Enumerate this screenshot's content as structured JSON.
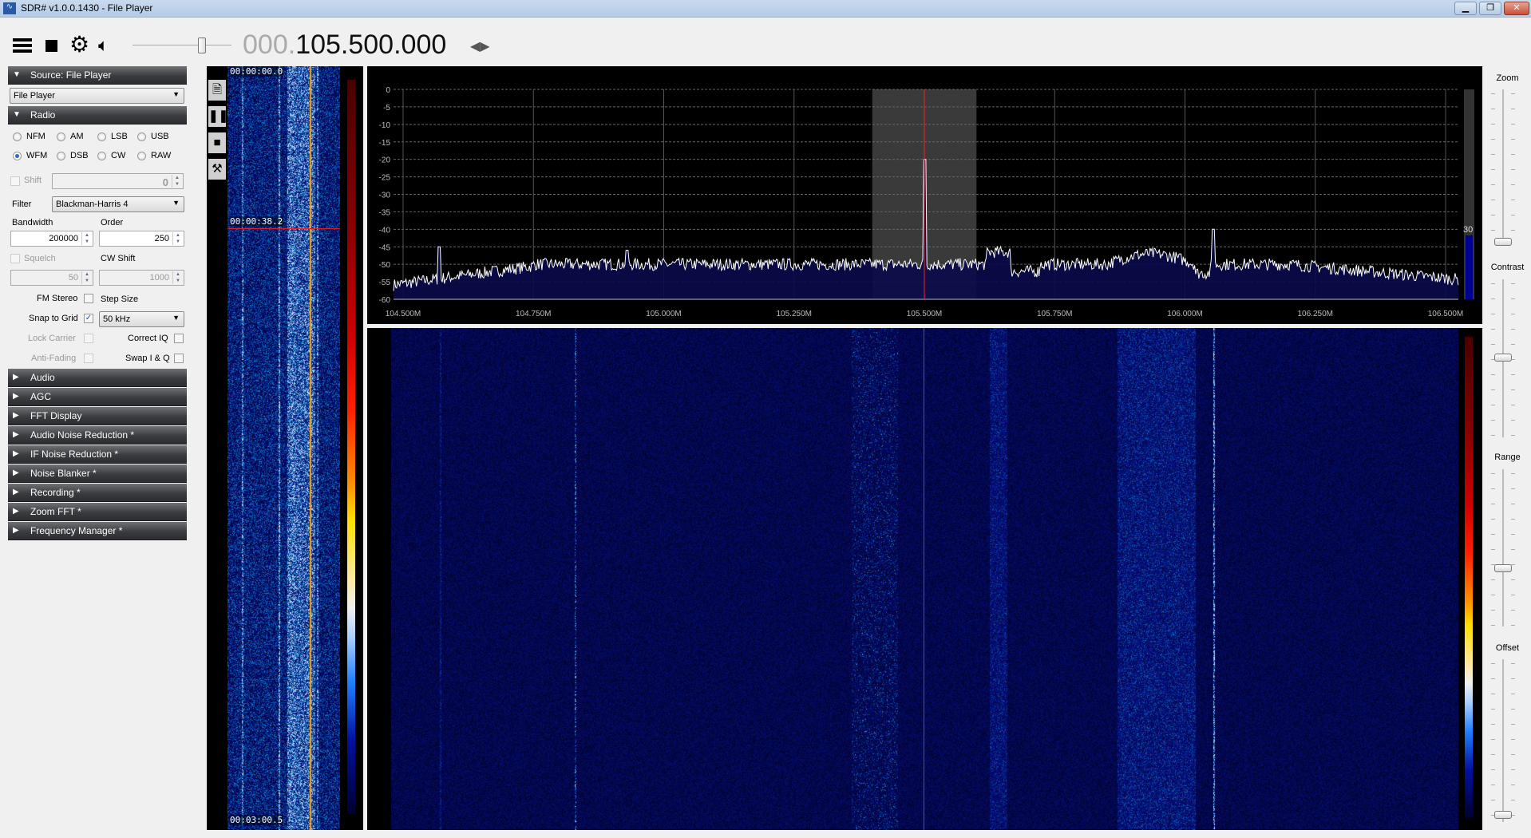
{
  "window": {
    "title": "SDR# v1.0.0.1430 - File Player",
    "controls": [
      "minimize",
      "restore",
      "close"
    ]
  },
  "toolbar": {
    "menu_icon": "hamburger-icon",
    "stop_icon": "stop-icon",
    "settings_icon": "gear-icon",
    "audio_icon": "speaker-icon",
    "volume_percent": 72,
    "freq_prefix": "000.",
    "frequency": "105.500.000",
    "tune_arrows_icon": "left-right-arrows-icon"
  },
  "source": {
    "header": "Source: File Player",
    "selected": "File Player"
  },
  "radio": {
    "header": "Radio",
    "modes": [
      {
        "label": "NFM",
        "on": false
      },
      {
        "label": "AM",
        "on": false
      },
      {
        "label": "LSB",
        "on": false
      },
      {
        "label": "USB",
        "on": false
      },
      {
        "label": "WFM",
        "on": true
      },
      {
        "label": "DSB",
        "on": false
      },
      {
        "label": "CW",
        "on": false
      },
      {
        "label": "RAW",
        "on": false
      }
    ],
    "shift_label": "Shift",
    "shift_value": "0",
    "filter_label": "Filter",
    "filter_value": "Blackman-Harris 4",
    "bandwidth_label": "Bandwidth",
    "bandwidth_value": "200000",
    "order_label": "Order",
    "order_value": "250",
    "squelch_label": "Squelch",
    "squelch_value": "50",
    "cwshift_label": "CW Shift",
    "cwshift_value": "1000",
    "fmstereo_label": "FM Stereo",
    "fmstereo_checked": false,
    "stepsize_label": "Step Size",
    "stepsize_value": "50 kHz",
    "snap_label": "Snap to Grid",
    "snap_checked": true,
    "lockcarrier_label": "Lock Carrier",
    "correctiq_label": "Correct IQ",
    "antifading_label": "Anti-Fading",
    "swapiq_label": "Swap I & Q"
  },
  "panels": [
    "Audio",
    "AGC",
    "FFT Display",
    "Audio Noise Reduction *",
    "IF Noise Reduction *",
    "Noise Blanker *",
    "Recording *",
    "Zoom FFT *",
    "Frequency Manager *"
  ],
  "player": {
    "timestamps": [
      "00:00:00.0",
      "00:00:38.2",
      "00:03:00.5"
    ],
    "icons": [
      "document-icon",
      "pause-icon",
      "stop-icon",
      "tools-icon"
    ]
  },
  "spectrum": {
    "y_ticks": [
      "0",
      "-5",
      "-10",
      "-15",
      "-20",
      "-25",
      "-30",
      "-35",
      "-40",
      "-45",
      "-50",
      "-55",
      "-60"
    ],
    "x_ticks": [
      "104.500M",
      "104.750M",
      "105.000M",
      "105.250M",
      "105.500M",
      "105.750M",
      "106.000M",
      "106.250M",
      "106.500M"
    ],
    "ylim": [
      -60,
      0
    ],
    "xlim_mhz": [
      104.5,
      106.5
    ],
    "center_mhz": 105.5,
    "filter_band_mhz": [
      105.4,
      105.6
    ],
    "peaks": [
      {
        "mhz": 104.57,
        "db": -45
      },
      {
        "mhz": 104.93,
        "db": -46
      },
      {
        "mhz": 105.5,
        "db": -20
      },
      {
        "mhz": 106.055,
        "db": -40
      }
    ],
    "level_label": "30",
    "colors": {
      "trace": "#ffffff",
      "fill": "#0a0a4a",
      "center": "#ff2020",
      "band": "#3a3a3a"
    }
  },
  "side": {
    "zoom_label": "Zoom",
    "contrast_label": "Contrast",
    "range_label": "Range",
    "offset_label": "Offset"
  }
}
